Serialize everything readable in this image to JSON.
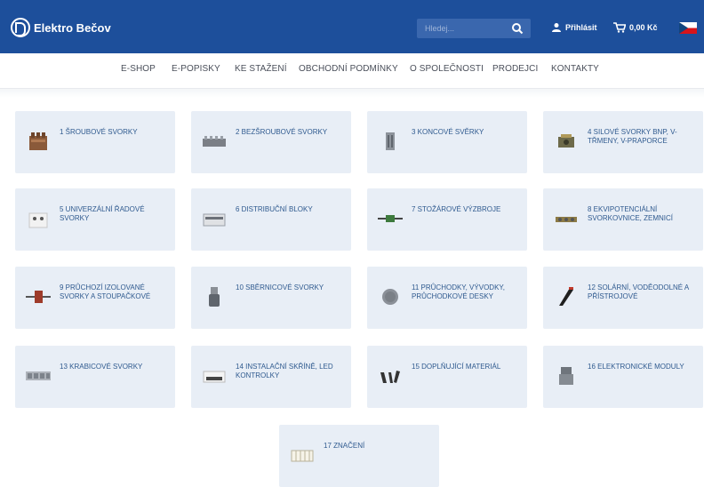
{
  "header": {
    "brand": "Elektro Bečov",
    "search_placeholder": "Hledej...",
    "login_label": "Přihlásit",
    "cart_total": "0,00 Kč"
  },
  "nav": {
    "items": [
      "E-SHOP",
      "E-POPISKY",
      "KE STAŽENÍ",
      "OBCHODNÍ PODMÍNKY",
      "O SPOLEČNOSTI",
      "PRODEJCI",
      "KONTAKTY"
    ]
  },
  "categories": [
    {
      "label": "1 ŠROUBOVÉ SVORKY"
    },
    {
      "label": "2 BEZŠROUBOVÉ SVORKY"
    },
    {
      "label": "3 KONCOVÉ SVĚRKY"
    },
    {
      "label": "4 SILOVÉ SVORKY BNP, V-TŘMENY, V-PRAPORCE"
    },
    {
      "label": "5 UNIVERZÁLNÍ ŘADOVÉ SVORKY"
    },
    {
      "label": "6 DISTRIBUČNÍ BLOKY"
    },
    {
      "label": "7 STOŽÁROVÉ VÝZBROJE"
    },
    {
      "label": "8 EKVIPOTENCIÁLNÍ SVORKOVNICE, ZEMNICÍ"
    },
    {
      "label": "9 PRŮCHOZÍ IZOLOVANÉ SVORKY A STOUPAČKOVÉ"
    },
    {
      "label": "10 SBĚRNICOVÉ SVORKY"
    },
    {
      "label": "11 PRŮCHODKY, VÝVODKY, PRŮCHODKOVÉ DESKY"
    },
    {
      "label": "12 SOLÁRNÍ, VODĚODOLNÉ A PŘÍSTROJOVÉ"
    },
    {
      "label": "13 KRABICOVÉ SVORKY"
    },
    {
      "label": "14 INSTALAČNÍ SKŘÍNĚ, LED KONTROLKY"
    },
    {
      "label": "15 DOPLŇUJÍCÍ MATERIÁL"
    },
    {
      "label": "16 ELEKTRONICKÉ MODULY"
    },
    {
      "label": "17 ZNAČENÍ"
    }
  ]
}
